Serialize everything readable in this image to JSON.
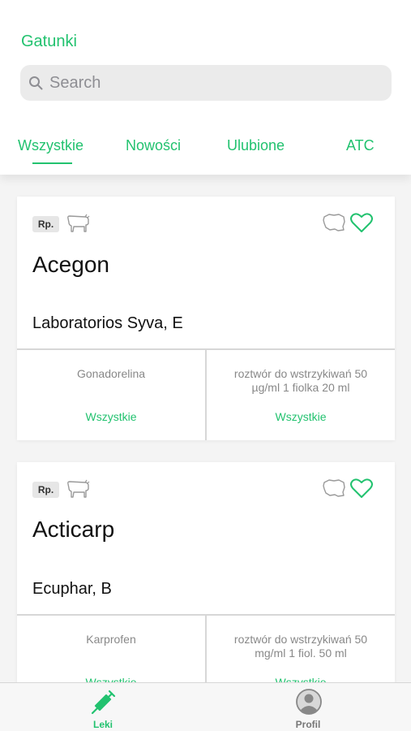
{
  "header": {
    "species_link": "Gatunki",
    "search_placeholder": "Search"
  },
  "tabs": [
    {
      "label": "Wszystkie",
      "active": true
    },
    {
      "label": "Nowości",
      "active": false
    },
    {
      "label": "Ulubione",
      "active": false
    },
    {
      "label": "ATC",
      "active": false
    }
  ],
  "cards": [
    {
      "badge": "Rp.",
      "name": "Acegon",
      "manufacturer": "Laboratorios Syva, E",
      "substance": "Gonadorelina",
      "form": "roztwór do wstrzykiwań 50 µg/ml 1 fiolka 20 ml",
      "left_link": "Wszystkie",
      "right_link": "Wszystkie"
    },
    {
      "badge": "Rp.",
      "name": "Acticarp",
      "manufacturer": "Ecuphar, B",
      "substance": "Karprofen",
      "form": "roztwór do wstrzykiwań 50 mg/ml 1 fiol. 50 ml",
      "left_link": "Wszystkie",
      "right_link": "Wszystkie"
    }
  ],
  "bottom_nav": [
    {
      "label": "Leki",
      "icon": "syringe-icon",
      "active": true
    },
    {
      "label": "Profil",
      "icon": "profile-icon",
      "active": false
    }
  ],
  "colors": {
    "accent": "#22c26f",
    "inactive": "#777777",
    "muted_text": "#888888"
  }
}
